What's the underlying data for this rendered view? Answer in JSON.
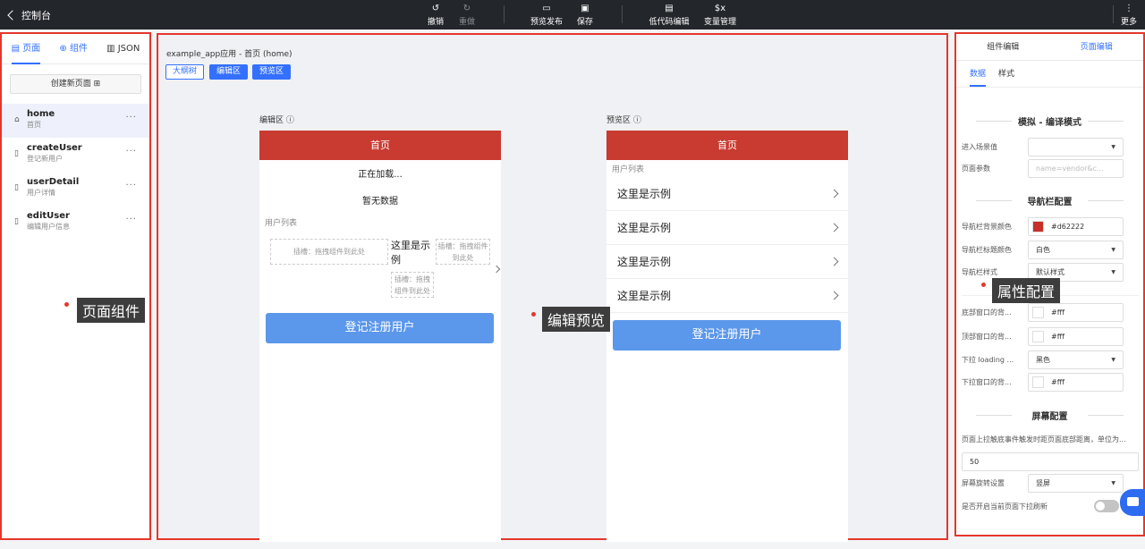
{
  "topbar": {
    "back_label": "控制台",
    "undo": "撤销",
    "redo": "重做",
    "preview_publish": "预览发布",
    "save": "保存",
    "lowcode": "低代码编辑",
    "variables": "变量管理",
    "more": "更多"
  },
  "left": {
    "tabs": {
      "pages": "页面",
      "components": "组件",
      "json": "JSON"
    },
    "create_page": "创建新页面",
    "pages": [
      {
        "name": "home",
        "sub": "首页"
      },
      {
        "name": "createUser",
        "sub": "登记新用户"
      },
      {
        "name": "userDetail",
        "sub": "用户详情"
      },
      {
        "name": "editUser",
        "sub": "编辑用户信息"
      }
    ],
    "callout": "页面组件"
  },
  "center": {
    "title": "example_app应用 - 首页 (home)",
    "btn_outline": "大纲树",
    "btn_edit": "编辑区",
    "btn_preview": "预览区",
    "callout": "编辑预览",
    "editor": {
      "label": "编辑区",
      "header": "首页",
      "loading": "正在加载...",
      "empty": "暂无数据",
      "list_label": "用户列表",
      "slot_text": "插槽：拖拽组件到此处",
      "example_text": "这里是示例",
      "register_btn": "登记注册用户"
    },
    "preview": {
      "label": "预览区",
      "header": "首页",
      "list_label": "用户列表",
      "rows": [
        "这里是示例",
        "这里是示例",
        "这里是示例",
        "这里是示例"
      ],
      "register_btn": "登记注册用户"
    }
  },
  "right": {
    "tabs": {
      "component": "组件编辑",
      "page": "页面编辑"
    },
    "subtabs": {
      "data": "数据",
      "style": "样式"
    },
    "section_sim": "模拟 - 编译模式",
    "scene_label": "进入场景值",
    "params_label": "页面参数",
    "params_placeholder": "name=vendor&c...",
    "section_nav": "导航栏配置",
    "nav_bg_label": "导航栏背景颜色",
    "nav_bg_value": "#d62222",
    "nav_bg_color": "#c7302a",
    "nav_title_label": "导航栏标题颜色",
    "nav_title_value": "白色",
    "nav_style_label": "导航栏样式",
    "nav_style_value": "默认样式",
    "callout": "属性配置",
    "bottom_bg_label": "底部窗口的背...",
    "bottom_bg_value": "#fff",
    "top_bg_label": "顶部窗口的背...",
    "top_bg_value": "#fff",
    "loading_label": "下拉 loading ...",
    "loading_value": "黑色",
    "pull_bg_label": "下拉窗口的背...",
    "pull_bg_value": "#fff",
    "section_screen": "屏幕配置",
    "reach_bottom_label": "页面上拉触底事件触发时距页面底部距离，单位为...",
    "reach_bottom_value": "50",
    "rotate_label": "屏幕旋转设置",
    "rotate_value": "竖屏",
    "pull_refresh_label": "是否开启当前页面下拉刷新"
  }
}
